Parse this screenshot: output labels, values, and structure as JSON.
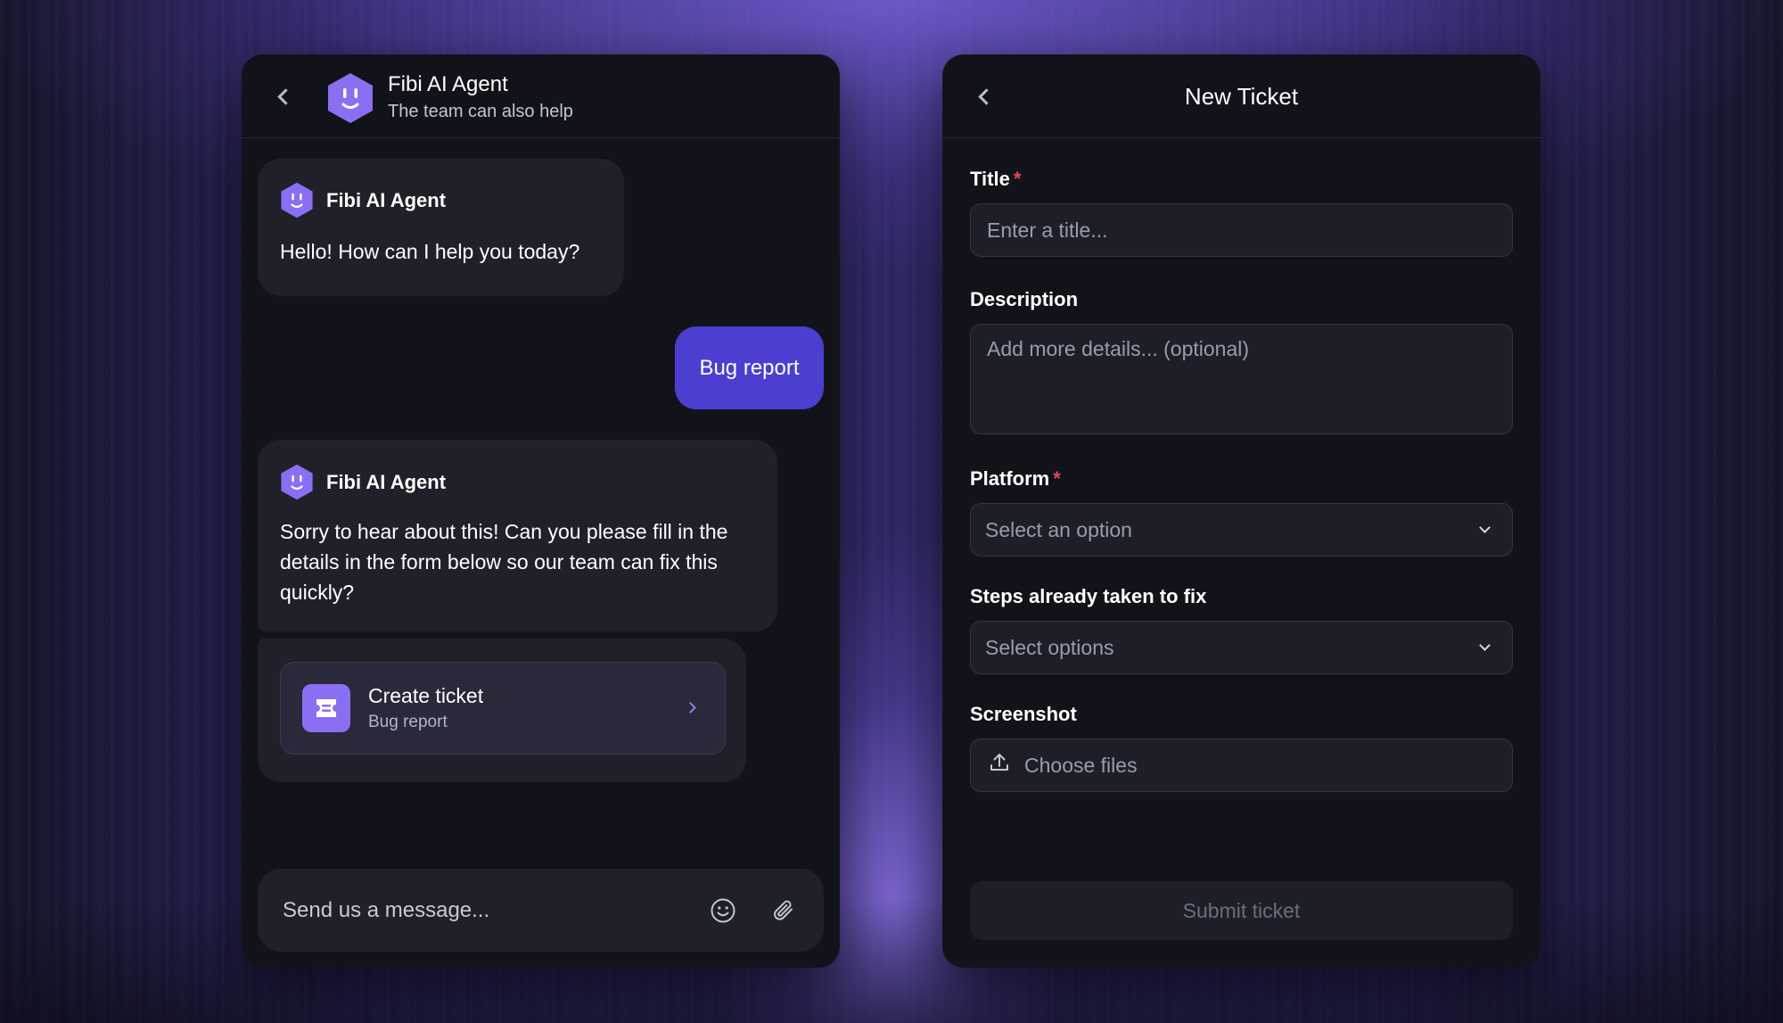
{
  "chat": {
    "header": {
      "title": "Fibi AI Agent",
      "subtitle": "The team can also help"
    },
    "messages": [
      {
        "sender": "Fibi AI Agent",
        "text": "Hello! How can I help you today?"
      },
      {
        "sender": "user",
        "text": "Bug report"
      },
      {
        "sender": "Fibi AI Agent",
        "text": "Sorry to hear about this! Can you please fill in the details in the form below so our team can fix this quickly?"
      }
    ],
    "ticket_card": {
      "title": "Create ticket",
      "subtitle": "Bug report"
    },
    "composer": {
      "placeholder": "Send us a message..."
    }
  },
  "ticket": {
    "title": "New Ticket",
    "fields": {
      "title": {
        "label": "Title",
        "required": "*",
        "placeholder": "Enter a title..."
      },
      "description": {
        "label": "Description",
        "placeholder": "Add more details... (optional)"
      },
      "platform": {
        "label": "Platform",
        "required": "*",
        "value": "Select an option"
      },
      "steps": {
        "label": "Steps already taken to fix",
        "value": "Select options"
      },
      "screenshot": {
        "label": "Screenshot",
        "value": "Choose files"
      }
    },
    "submit_label": "Submit ticket"
  },
  "colors": {
    "accent": "#4a3fd0",
    "avatar": "#8b6ff2",
    "required": "#e5484d",
    "panel": "#12131a"
  }
}
